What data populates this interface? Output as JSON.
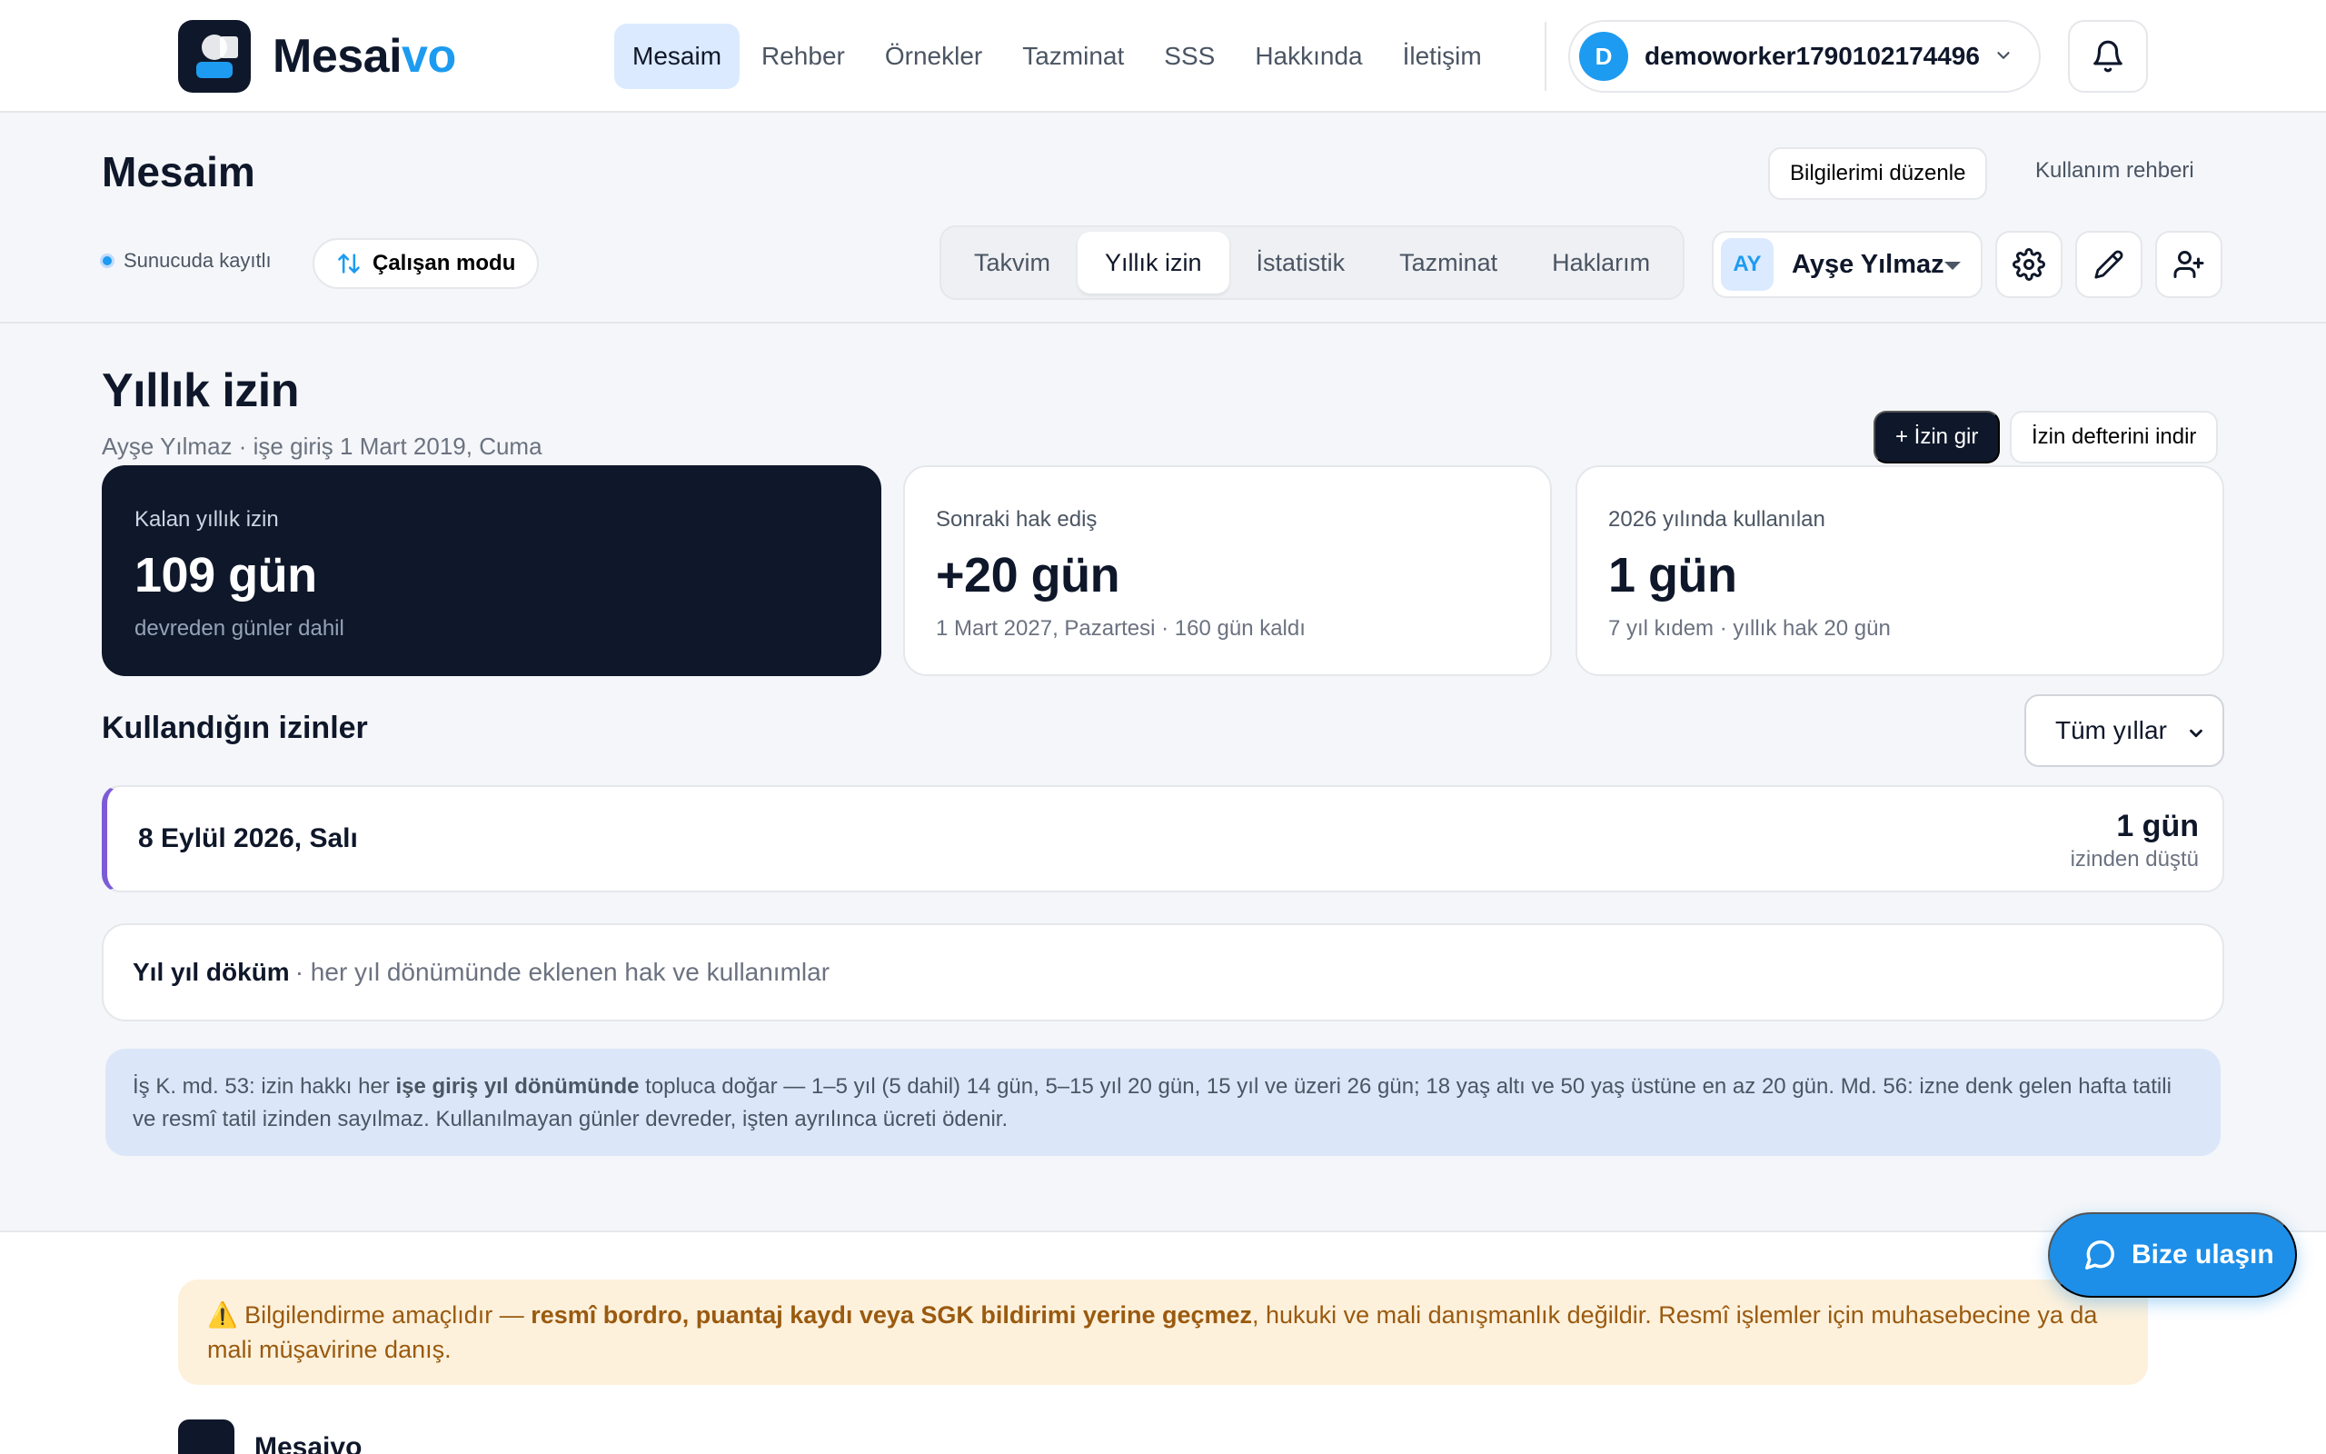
{
  "nav": {
    "brand_prefix": "Mesai",
    "brand_accent": "vo",
    "links": [
      "Mesaim",
      "Rehber",
      "Örnekler",
      "Tazminat",
      "SSS",
      "Hakkında",
      "İletişim"
    ],
    "user_initial": "D",
    "user_name": "demoworker1790102174496"
  },
  "subheader": {
    "title": "Mesaim",
    "edit_info": "Bilgilerimi düzenle",
    "guide": "Kullanım rehberi",
    "status": "Sunucuda kayıtlı",
    "mode": "Çalışan modu",
    "tabs": [
      "Takvim",
      "Yıllık izin",
      "İstatistik",
      "Tazminat",
      "Haklarım"
    ],
    "person_initials": "AY",
    "person_name": "Ayşe Yılmaz"
  },
  "main": {
    "title": "Yıllık izin",
    "subtitle": "Ayşe Yılmaz · işe giriş 1 Mart 2019, Cuma",
    "add_leave": "+ İzin gir",
    "download": "İzin defterini indir",
    "cards": [
      {
        "label": "Kalan yıllık izin",
        "value": "109 gün",
        "note": "devreden günler dahil"
      },
      {
        "label": "Sonraki hak ediş",
        "value": "+20 gün",
        "note": "1 Mart 2027, Pazartesi · 160 gün kaldı"
      },
      {
        "label": "2026 yılında kullanılan",
        "value": "1 gün",
        "note": "7 yıl kıdem · yıllık hak 20 gün"
      }
    ],
    "list_title": "Kullandığın izinler",
    "year_filter": "Tüm yıllar",
    "leaves": [
      {
        "date": "8 Eylül 2026, Salı",
        "days": "1 gün",
        "desc": "izinden düştü"
      }
    ],
    "breakdown_title": "Yıl yıl döküm",
    "breakdown_desc": "· her yıl dönümünde eklenen hak ve kullanımlar",
    "info_pre": "İş K. md. 53: izin hakkı her ",
    "info_bold": "işe giriş yıl dönümünde",
    "info_post": " topluca doğar — 1–5 yıl (5 dahil) 14 gün, 5–15 yıl 20 gün, 15 yıl ve üzeri 26 gün; 18 yaş altı ve 50 yaş üstüne en az 20 gün. Md. 56: izne denk gelen hafta tatili ve resmî tatil izinden sayılmaz. Kullanılmayan günler devreder, işten ayrılınca ücreti ödenir."
  },
  "footer": {
    "warn_pre": "⚠️ Bilgilendirme amaçlıdır — ",
    "warn_bold": "resmî bordro, puantaj kaydı veya SGK bildirimi yerine geçmez",
    "warn_post": ", hukuki ve mali danışmanlık değildir. Resmî işlemler için muhasebecine ya da mali müşavirine danış.",
    "brand": "Mesaivo"
  },
  "contact": "Bize ulaşın",
  "colors": {
    "accent": "#1d9bf0",
    "dark": "#0f172a",
    "leave_marker": "#7c5cd6",
    "info_bg": "#dbe7f8",
    "warn_bg": "#fdf1dc"
  },
  "icons": [
    "bell-icon",
    "swap-icon",
    "gear-icon",
    "pencil-icon",
    "add-user-icon",
    "chat-icon",
    "chevron-down-icon"
  ]
}
